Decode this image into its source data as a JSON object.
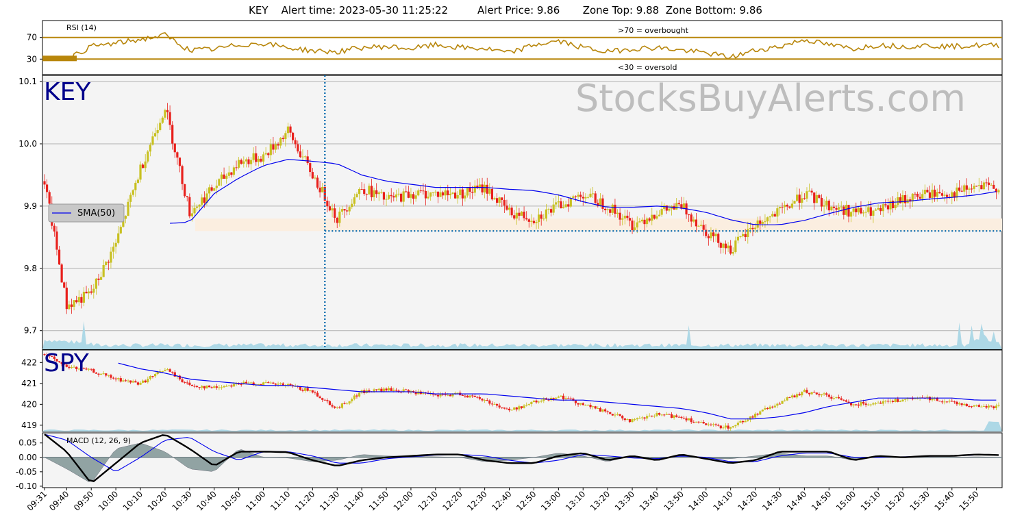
{
  "header": {
    "symbol": "KEY",
    "alert_time": "Alert time: 2023-05-30 11:25:22",
    "alert_price": "Alert Price: 9.86",
    "zone_top": "Zone Top: 9.88",
    "zone_bottom": "Zone Bottom: 9.86"
  },
  "watermark": "StocksBuyAlerts.com",
  "colors": {
    "up_candle": "#c8c020",
    "down_candle": "#e8201c",
    "sma": "#0000ee",
    "rsi": "#b8860b",
    "volume": "#add8e6",
    "zone": "#fbeee0",
    "alert_line": "#1f77b4",
    "macd": "#000000",
    "signal": "#0000ee",
    "histogram": "#7f9494",
    "panel_bg": "#f4f4f4",
    "ticker_label": "#00008b"
  },
  "rsi_panel": {
    "label": "RSI (14)",
    "overbought_label": ">70 = overbought",
    "oversold_label": "<30 = oversold",
    "y_ticks": [
      "70",
      "30"
    ]
  },
  "key_panel": {
    "ticker": "KEY",
    "legend": "SMA(50)",
    "y_ticks": [
      "10.1",
      "10.0",
      "9.9",
      "9.8",
      "9.7"
    ]
  },
  "spy_panel": {
    "ticker": "SPY",
    "y_ticks": [
      "422",
      "421",
      "420",
      "419"
    ]
  },
  "macd_panel": {
    "label": "MACD (12, 26, 9)",
    "y_ticks": [
      "0.05",
      "0.00",
      "-0.05",
      "-0.10"
    ]
  },
  "x_axis": {
    "ticks": [
      "09:31",
      "09:40",
      "09:50",
      "10:00",
      "10:10",
      "10:20",
      "10:30",
      "10:40",
      "10:50",
      "11:00",
      "11:10",
      "11:20",
      "11:30",
      "11:40",
      "11:50",
      "12:00",
      "12:10",
      "12:20",
      "12:30",
      "12:40",
      "12:50",
      "13:00",
      "13:10",
      "13:20",
      "13:30",
      "13:40",
      "13:50",
      "14:00",
      "14:10",
      "14:20",
      "14:30",
      "14:40",
      "14:50",
      "15:00",
      "15:10",
      "15:20",
      "15:30",
      "15:40",
      "15:50"
    ]
  },
  "chart_data": {
    "type": "line",
    "x": [
      "09:31",
      "09:40",
      "09:50",
      "10:00",
      "10:10",
      "10:20",
      "10:30",
      "10:40",
      "10:50",
      "11:00",
      "11:10",
      "11:20",
      "11:30",
      "11:40",
      "11:50",
      "12:00",
      "12:10",
      "12:20",
      "12:30",
      "12:40",
      "12:50",
      "13:00",
      "13:10",
      "13:20",
      "13:30",
      "13:40",
      "13:50",
      "14:00",
      "14:10",
      "14:20",
      "14:30",
      "14:40",
      "14:50",
      "15:00",
      "15:10",
      "15:20",
      "15:30",
      "15:40",
      "15:50",
      "15:59"
    ],
    "key_close": [
      9.94,
      9.74,
      9.76,
      9.84,
      9.96,
      10.06,
      9.89,
      9.93,
      9.97,
      9.98,
      10.02,
      9.95,
      9.88,
      9.93,
      9.91,
      9.92,
      9.92,
      9.92,
      9.93,
      9.89,
      9.88,
      9.9,
      9.92,
      9.9,
      9.87,
      9.89,
      9.9,
      9.86,
      9.83,
      9.87,
      9.89,
      9.92,
      9.9,
      9.89,
      9.89,
      9.91,
      9.92,
      9.92,
      9.93,
      9.93
    ],
    "key_sma50": [
      null,
      null,
      null,
      null,
      null,
      9.872,
      9.874,
      9.92,
      9.945,
      9.965,
      9.975,
      9.972,
      9.968,
      9.95,
      9.94,
      9.935,
      9.93,
      9.93,
      9.93,
      9.927,
      9.925,
      9.918,
      9.907,
      9.898,
      9.898,
      9.9,
      9.897,
      9.89,
      9.878,
      9.87,
      9.87,
      9.877,
      9.888,
      9.898,
      9.905,
      9.907,
      9.911,
      9.914,
      9.918,
      9.924
    ],
    "spy_close": [
      422.4,
      421.8,
      421.6,
      421.2,
      421.0,
      421.7,
      420.9,
      420.8,
      421.0,
      421.0,
      420.9,
      420.6,
      419.8,
      420.6,
      420.7,
      420.6,
      420.4,
      420.5,
      420.2,
      419.7,
      420.1,
      420.4,
      420.0,
      419.6,
      419.2,
      419.5,
      419.4,
      419.0,
      418.9,
      419.5,
      420.1,
      420.6,
      420.4,
      420.0,
      420.1,
      420.2,
      420.3,
      420.1,
      419.9,
      419.9
    ],
    "spy_sma50": [
      null,
      null,
      null,
      422.0,
      421.7,
      421.5,
      421.2,
      421.1,
      421.0,
      420.9,
      420.9,
      420.8,
      420.7,
      420.6,
      420.6,
      420.6,
      420.5,
      420.5,
      420.5,
      420.4,
      420.3,
      420.2,
      420.2,
      420.1,
      420.0,
      419.9,
      419.8,
      419.6,
      419.3,
      419.3,
      419.4,
      419.6,
      419.9,
      420.1,
      420.3,
      420.3,
      420.3,
      420.3,
      420.2,
      420.2
    ],
    "rsi": [
      25,
      28,
      52,
      58,
      65,
      73,
      45,
      47,
      55,
      58,
      50,
      44,
      42,
      50,
      52,
      48,
      55,
      50,
      48,
      40,
      55,
      62,
      50,
      42,
      48,
      50,
      45,
      40,
      32,
      45,
      52,
      65,
      55,
      48,
      55,
      52,
      54,
      52,
      54,
      54
    ],
    "macd": [
      0.08,
      0.02,
      -0.09,
      -0.02,
      0.05,
      0.08,
      0.03,
      -0.03,
      0.02,
      0.02,
      0.018,
      -0.01,
      -0.03,
      -0.01,
      0.0,
      0.005,
      0.01,
      0.01,
      -0.01,
      -0.02,
      -0.02,
      0.005,
      0.015,
      -0.01,
      0.005,
      -0.01,
      0.01,
      -0.005,
      -0.02,
      -0.01,
      0.02,
      0.02,
      0.02,
      -0.01,
      0.005,
      0.0,
      0.005,
      0.005,
      0.01,
      0.008
    ],
    "macd_signal": [
      0.08,
      0.06,
      0.0,
      -0.05,
      0.0,
      0.06,
      0.07,
      0.02,
      -0.01,
      0.02,
      0.02,
      0.005,
      -0.02,
      -0.02,
      -0.005,
      0.002,
      0.008,
      0.01,
      0.005,
      -0.01,
      -0.02,
      -0.01,
      0.01,
      0.005,
      -0.002,
      -0.005,
      0.005,
      0.0,
      -0.015,
      -0.015,
      0.005,
      0.015,
      0.015,
      0.0,
      0.0,
      0.002,
      0.004,
      0.005,
      0.008,
      0.008
    ],
    "alert_time": "11:25",
    "alert_price": 9.86,
    "zone": [
      9.86,
      9.88
    ],
    "ylim_key": [
      9.67,
      10.11
    ],
    "ylim_rsi": [
      0,
      100
    ],
    "ylim_spy": [
      418.7,
      422.6
    ],
    "ylim_macd": [
      -0.105,
      0.085
    ]
  }
}
